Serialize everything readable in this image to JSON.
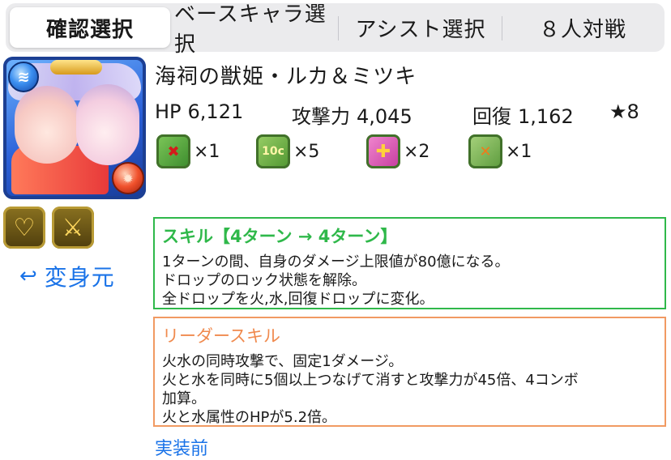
{
  "tabs": [
    {
      "label": "確認選択",
      "active": true
    },
    {
      "label": "ベースキャラ選択",
      "active": false
    },
    {
      "label": "アシスト選択",
      "active": false
    },
    {
      "label": "８人対戦",
      "active": false
    }
  ],
  "monster": {
    "name": "海祠の獣姫・ルカ＆ミツキ",
    "main_attribute": "water-orb-icon",
    "sub_attribute": "fire-orb-icon"
  },
  "stats": {
    "hp_label": "HP",
    "hp_value": "6,121",
    "atk_label": "攻撃力",
    "atk_value": "4,045",
    "rcv_label": "回復",
    "rcv_value": "1,162",
    "star_label": "★8"
  },
  "latents": [
    {
      "icon": "skill-delay-resist-icon",
      "count": "×1"
    },
    {
      "icon": "combo-10-icon",
      "count": "×5"
    },
    {
      "icon": "heal-plus-icon",
      "count": "×2"
    },
    {
      "icon": "bind-resist-icon",
      "count": "×1"
    }
  ],
  "awakenings": [
    {
      "icon": "heart-awakening-icon"
    },
    {
      "icon": "sword-awakening-icon"
    }
  ],
  "back_link": "変身元",
  "skill": {
    "header": "スキル【4ターン → 4ターン】",
    "lines": [
      "1ターンの間、自身のダメージ上限値が80億になる。",
      "ドロップのロック状態を解除。",
      "全ドロップを火,水,回復ドロップに変化。"
    ]
  },
  "leader_skill": {
    "header": "リーダースキル",
    "lines": [
      "火水の同時攻撃で、固定1ダメージ。",
      "火と水を同時に5個以上つなげて消すと攻撃力が45倍、4コンボ",
      "加算。",
      "火と水属性のHPが5.2倍。"
    ]
  },
  "status_text": "実装前",
  "colors": {
    "link_blue": "#1a73e8",
    "skill_green": "#2fb84a",
    "leader_orange": "#f19a62"
  }
}
